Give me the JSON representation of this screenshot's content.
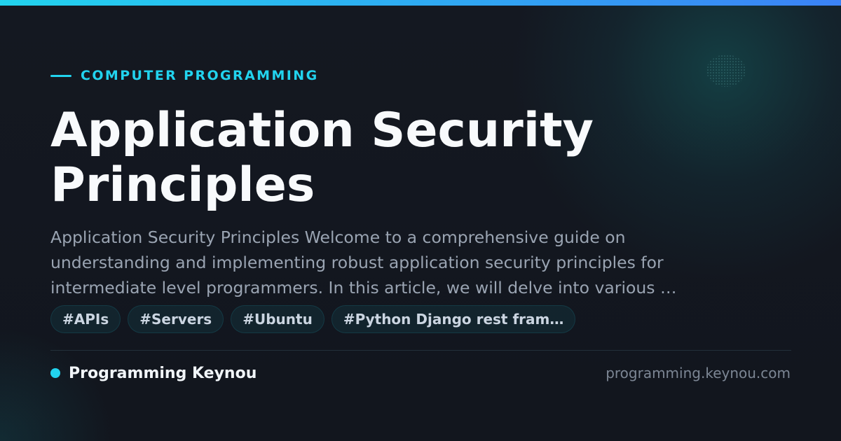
{
  "theme": {
    "accent": "#22d3ee",
    "accent_end": "#3b82f6",
    "background": "#12161f",
    "title_color": "#f8fafc",
    "excerpt_color": "#9aa4b2",
    "muted": "#7c8694"
  },
  "category": "COMPUTER PROGRAMMING",
  "title_lines": [
    "Application Security",
    "Principles"
  ],
  "excerpt_lines": [
    "Application Security Principles Welcome to a comprehensive guide on",
    "understanding and implementing robust application security principles for",
    "intermediate level programmers. In this article, we will delve into various …"
  ],
  "tags": [
    "#APIs",
    "#Servers",
    "#Ubuntu",
    "#Python Django rest fram…"
  ],
  "footer": {
    "site_name": "Programming Keynou",
    "domain": "programming.keynou.com"
  }
}
